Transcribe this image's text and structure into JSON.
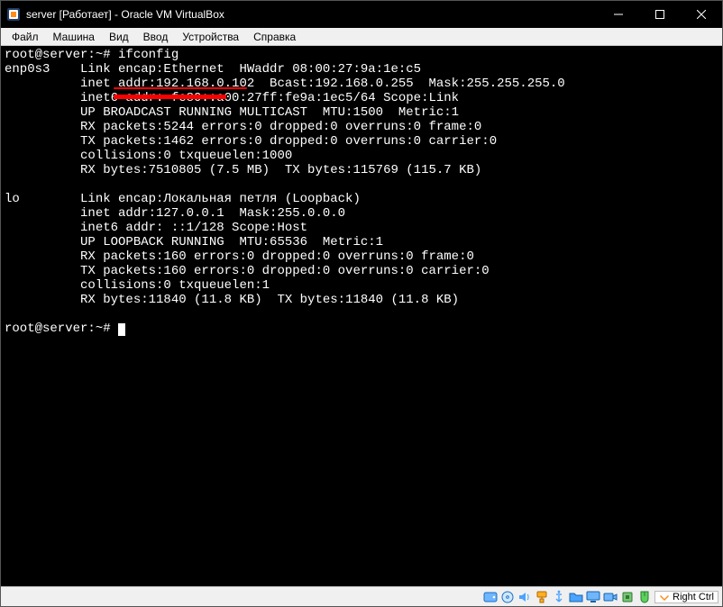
{
  "titlebar": {
    "title": "server [Работает] - Oracle VM VirtualBox"
  },
  "menu": {
    "file": "Файл",
    "machine": "Машина",
    "view": "Вид",
    "input": "Ввод",
    "devices": "Устройства",
    "help": "Справка"
  },
  "terminal": {
    "line1": "root@server:~# ifconfig",
    "line2": "enp0s3    Link encap:Ethernet  HWaddr 08:00:27:9a:1e:c5",
    "line3": "          inet addr:192.168.0.102  Bcast:192.168.0.255  Mask:255.255.255.0",
    "line4": "          inet6 addr: fe80::a00:27ff:fe9a:1ec5/64 Scope:Link",
    "line5": "          UP BROADCAST RUNNING MULTICAST  MTU:1500  Metric:1",
    "line6": "          RX packets:5244 errors:0 dropped:0 overruns:0 frame:0",
    "line7": "          TX packets:1462 errors:0 dropped:0 overruns:0 carrier:0",
    "line8": "          collisions:0 txqueuelen:1000",
    "line9": "          RX bytes:7510805 (7.5 MB)  TX bytes:115769 (115.7 KB)",
    "line10": "",
    "line11": "lo        Link encap:Локальная петля (Loopback)",
    "line12": "          inet addr:127.0.0.1  Mask:255.0.0.0",
    "line13": "          inet6 addr: ::1/128 Scope:Host",
    "line14": "          UP LOOPBACK RUNNING  MTU:65536  Metric:1",
    "line15": "          RX packets:160 errors:0 dropped:0 overruns:0 frame:0",
    "line16": "          TX packets:160 errors:0 dropped:0 overruns:0 carrier:0",
    "line17": "          collisions:0 txqueuelen:1",
    "line18": "          RX bytes:11840 (11.8 KB)  TX bytes:11840 (11.8 KB)",
    "line19": "",
    "prompt": "root@server:~# "
  },
  "status": {
    "hostkey": "Right Ctrl"
  }
}
